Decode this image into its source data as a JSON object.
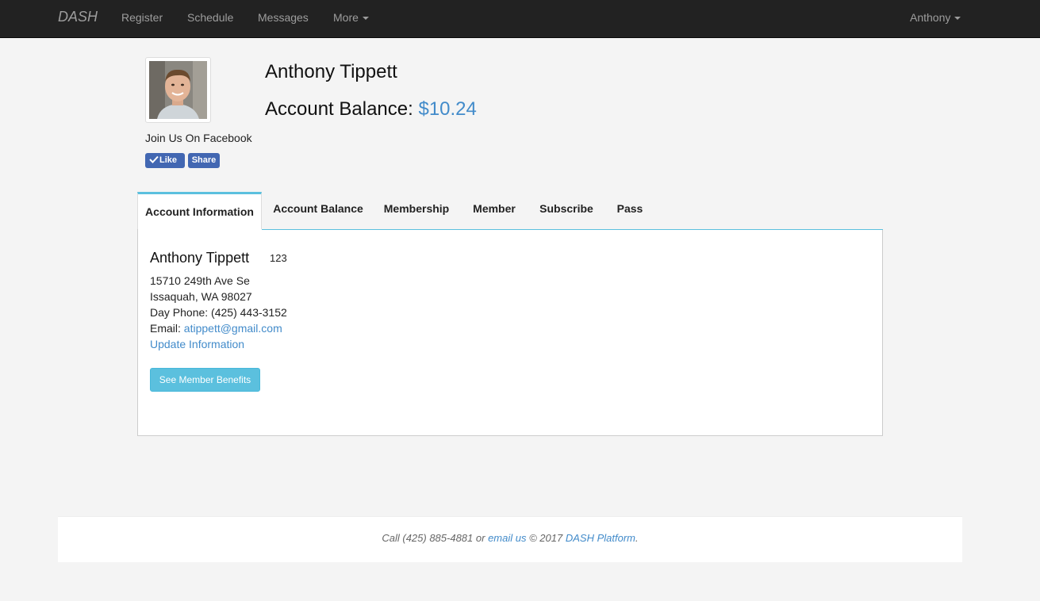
{
  "navbar": {
    "brand": "DASH",
    "links": [
      "Register",
      "Schedule",
      "Messages"
    ],
    "more_label": "More",
    "user_label": "Anthony"
  },
  "profile": {
    "name": "Anthony Tippett",
    "balance_label": "Account Balance:",
    "balance_amount": "$10.24",
    "facebook_label": "Join Us On Facebook",
    "like_label": "Like",
    "share_label": "Share"
  },
  "tabs": [
    "Account Information",
    "Account Balance",
    "Membership",
    "Member",
    "Subscribe",
    "Pass"
  ],
  "account": {
    "name": "Anthony Tippett",
    "member_id": "123",
    "address_line1": "15710 249th Ave Se",
    "address_line2": "Issaquah, WA 98027",
    "day_phone": "Day Phone: (425) 443-3152",
    "email_label": "Email:",
    "email": "atippett@gmail.com",
    "update_link": "Update Information",
    "benefits_button": "See Member Benefits"
  },
  "footer": {
    "call_text": "Call (425) 885-4881 or",
    "email_link": "email us",
    "copyright": "© 2017",
    "platform_link": "DASH Platform",
    "period": "."
  },
  "colors": {
    "navbar_bg": "#222222",
    "link": "#428bca",
    "info_button": "#5bc0de",
    "facebook": "#4267b2"
  }
}
